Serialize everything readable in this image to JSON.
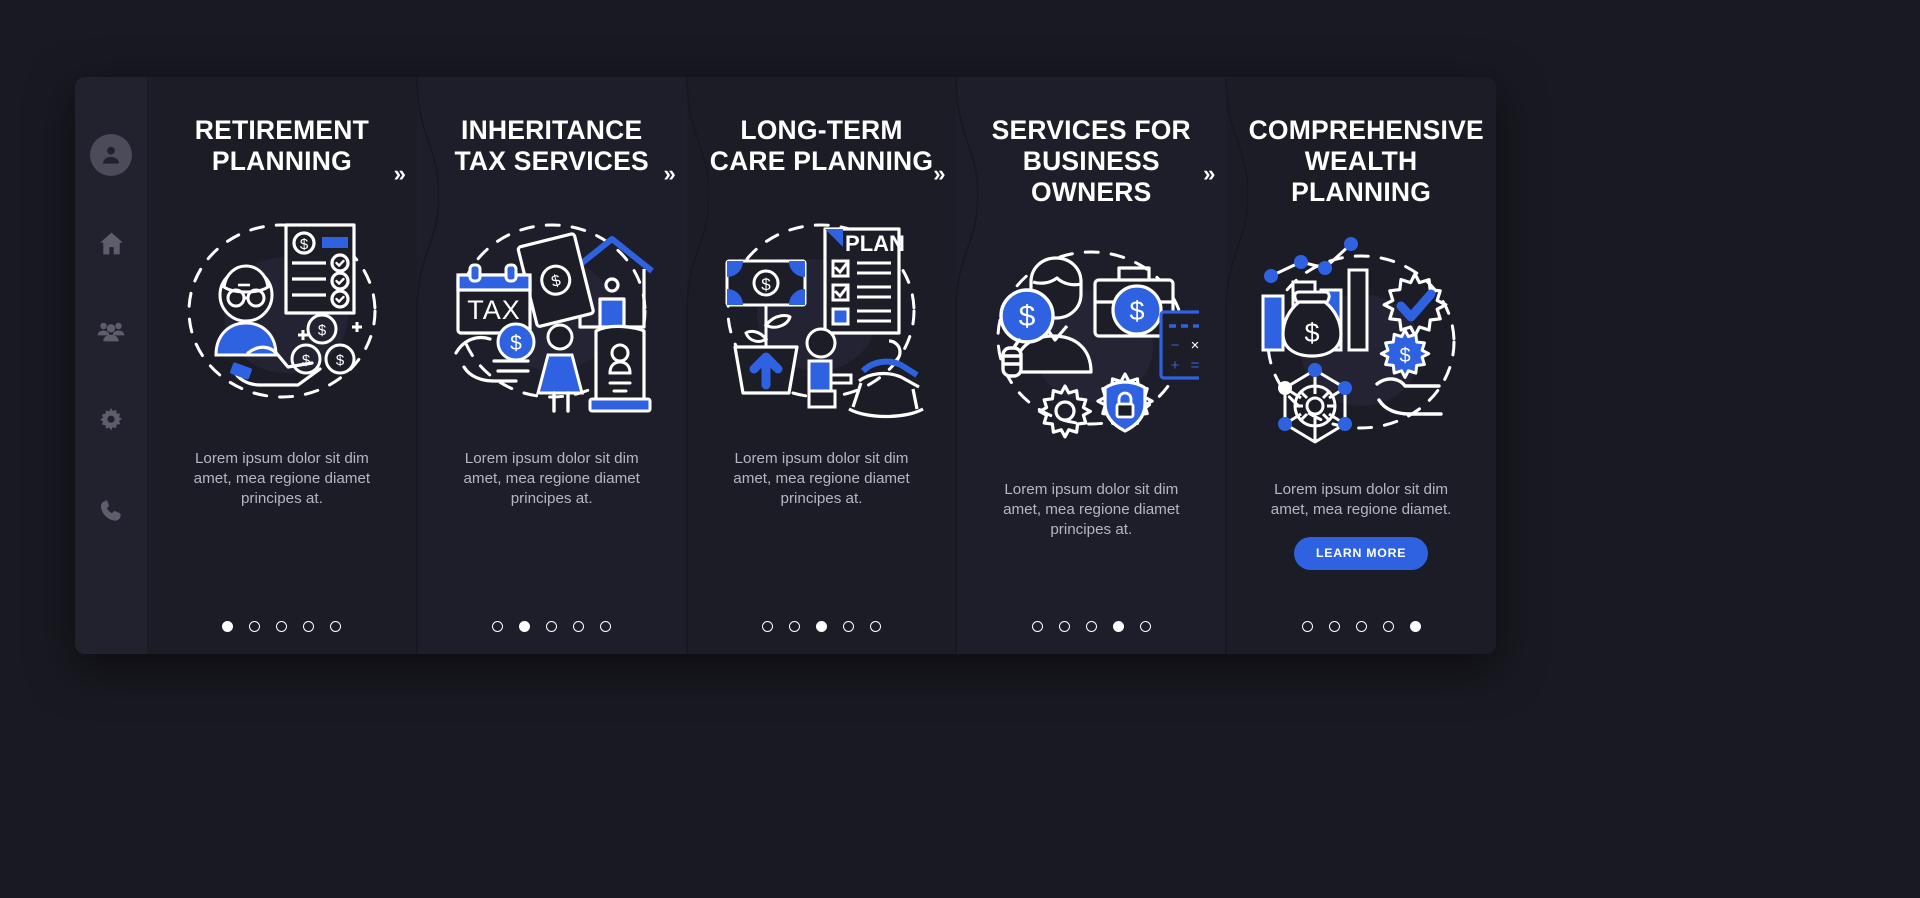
{
  "page": {
    "background_color": "#191922",
    "card_background": "#1d1d28",
    "accent_color": "#2f62e0",
    "text_color": "#ffffff",
    "body_text_color": "#b6b6c2"
  },
  "sidebar": {
    "items": [
      {
        "icon": "user-avatar-icon",
        "name": "sidebar-item-profile"
      },
      {
        "icon": "home-icon",
        "name": "sidebar-item-home"
      },
      {
        "icon": "people-group-icon",
        "name": "sidebar-item-clients"
      },
      {
        "icon": "gear-icon",
        "name": "sidebar-item-settings"
      },
      {
        "icon": "phone-icon",
        "name": "sidebar-item-contact"
      }
    ]
  },
  "separator": {
    "glyph": "»",
    "name": "chevron-right-double-icon"
  },
  "panels": [
    {
      "title": "RETIREMENT PLANNING",
      "body": "Lorem ipsum dolor sit dim amet, mea regione diamet principes at.",
      "illustration": "retirement-planning-illustration",
      "dots_total": 5,
      "dots_active": 1,
      "button": null
    },
    {
      "title": "INHERITANCE TAX SERVICES",
      "body": "Lorem ipsum dolor sit dim amet, mea regione diamet principes at.",
      "illustration": "inheritance-tax-illustration",
      "dots_total": 5,
      "dots_active": 2,
      "button": null
    },
    {
      "title": "LONG-TERM CARE PLANNING",
      "body": "Lorem ipsum dolor sit dim amet, mea regione diamet principes at.",
      "illustration": "long-term-care-illustration",
      "dots_total": 5,
      "dots_active": 3,
      "button": null
    },
    {
      "title": "SERVICES FOR BUSINESS OWNERS",
      "body": "Lorem ipsum dolor sit dim amet, mea regione diamet principes at.",
      "illustration": "business-owners-illustration",
      "dots_total": 5,
      "dots_active": 4,
      "button": null
    },
    {
      "title": "COMPREHENSIVE WEALTH PLANNING",
      "body": "Lorem ipsum dolor sit dim amet, mea regione diamet.",
      "illustration": "wealth-planning-illustration",
      "dots_total": 5,
      "dots_active": 5,
      "button": "LEARN MORE"
    }
  ],
  "illustration_labels": {
    "plan": "PLAN",
    "tax": "TAX",
    "dollar": "$",
    "plus": "+",
    "minus": "−",
    "times": "×",
    "equals": "="
  }
}
